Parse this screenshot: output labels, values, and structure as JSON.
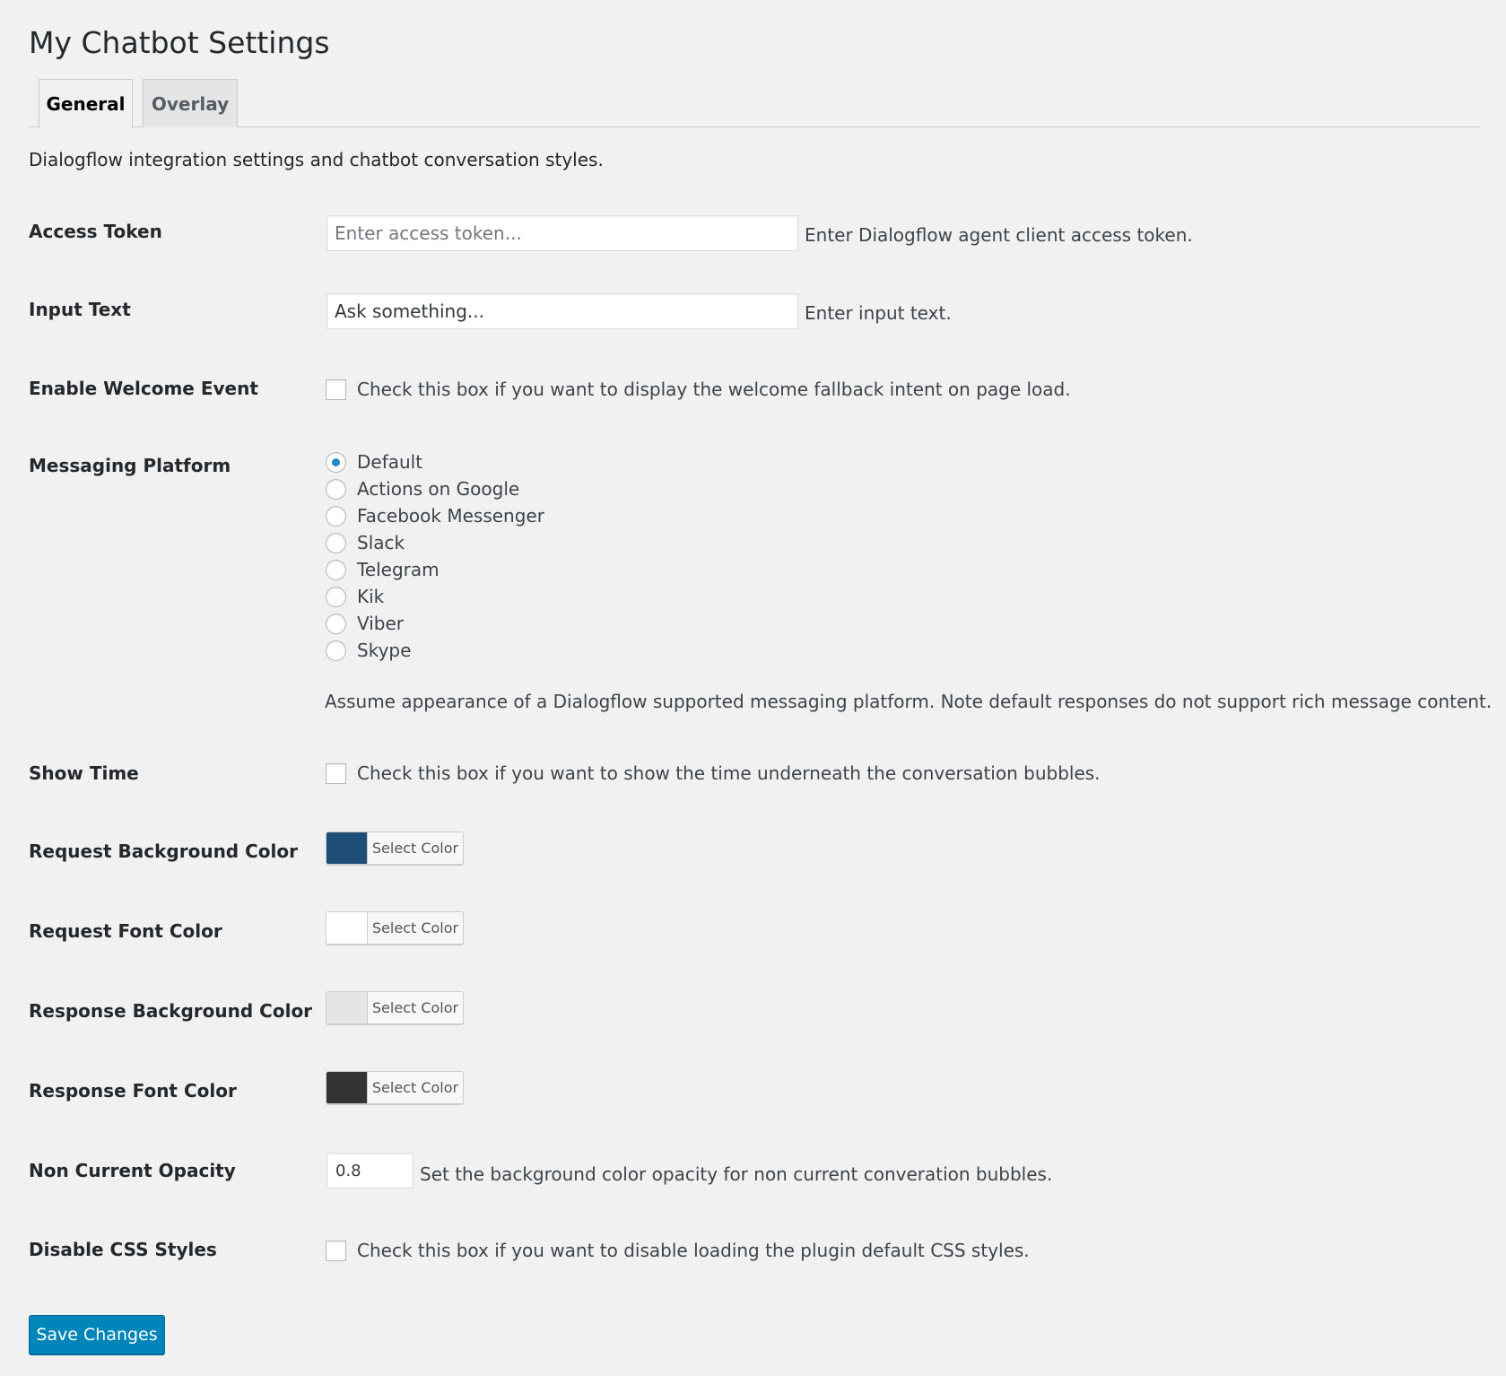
{
  "page": {
    "title": "My Chatbot Settings"
  },
  "tabs": [
    {
      "label": "General",
      "active": true
    },
    {
      "label": "Overlay",
      "active": false
    }
  ],
  "intro": "Dialogflow integration settings and chatbot conversation styles.",
  "access_token": {
    "label": "Access Token",
    "placeholder": "Enter access token...",
    "value": "",
    "description": "Enter Dialogflow agent client access token."
  },
  "input_text": {
    "label": "Input Text",
    "value": "Ask something...",
    "description": "Enter input text."
  },
  "welcome_event": {
    "label": "Enable Welcome Event",
    "checked": false,
    "description": "Check this box if you want to display the welcome fallback intent on page load."
  },
  "messaging_platform": {
    "label": "Messaging Platform",
    "selected": "Default",
    "options": [
      "Default",
      "Actions on Google",
      "Facebook Messenger",
      "Slack",
      "Telegram",
      "Kik",
      "Viber",
      "Skype"
    ],
    "description": "Assume appearance of a Dialogflow supported messaging platform. Note default responses do not support rich message content."
  },
  "show_time": {
    "label": "Show Time",
    "checked": false,
    "description": "Check this box if you want to show the time underneath the conversation bubbles."
  },
  "colors": {
    "button_label": "Select Color",
    "request_bg": {
      "label": "Request Background Color",
      "value": "#1e4d78"
    },
    "request_font": {
      "label": "Request Font Color",
      "value": "#ffffff"
    },
    "response_bg": {
      "label": "Response Background Color",
      "value": "#e5e5e5"
    },
    "response_font": {
      "label": "Response Font Color",
      "value": "#323232"
    }
  },
  "opacity": {
    "label": "Non Current Opacity",
    "value": "0.8",
    "description": "Set the background color opacity for non current converation bubbles."
  },
  "disable_css": {
    "label": "Disable CSS Styles",
    "checked": false,
    "description": "Check this box if you want to disable loading the plugin default CSS styles."
  },
  "save_button": {
    "label": "Save Changes"
  },
  "theme": {
    "accent": "#0085ba",
    "radio_dot": "#1e8cbe"
  }
}
